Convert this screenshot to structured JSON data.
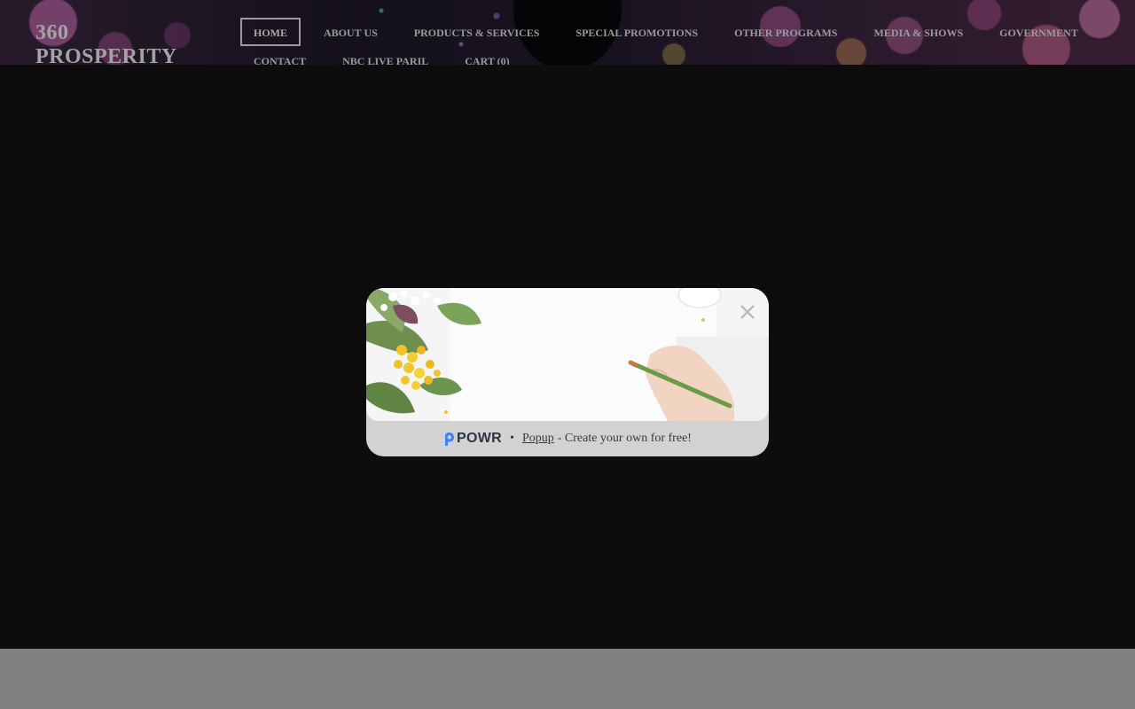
{
  "site": {
    "logo_line1": "360",
    "logo_line2": "PROSPERITY"
  },
  "nav": {
    "row1": [
      {
        "label": "HOME",
        "active": true
      },
      {
        "label": "ABOUT US"
      },
      {
        "label": "PRODUCTS & SERVICES"
      },
      {
        "label": "SPECIAL PROMOTIONS"
      },
      {
        "label": "OTHER PROGRAMS"
      },
      {
        "label": "MEDIA & SHOWS"
      },
      {
        "label": "GOVERNMENT"
      }
    ],
    "row2": [
      {
        "label": "CONTACT"
      },
      {
        "label": "NBC LIVE PARIL"
      },
      {
        "label": "CART (0)"
      }
    ]
  },
  "popup": {
    "brand": "POWR",
    "separator": "•",
    "link_text": "Popup",
    "tagline": "- Create your own for free!",
    "close_icon": "close-icon",
    "colors": {
      "overlay": "#0d0d0d",
      "popup_footer_bg": "#d2d2d2",
      "powr_blue": "#3b82f6"
    }
  }
}
